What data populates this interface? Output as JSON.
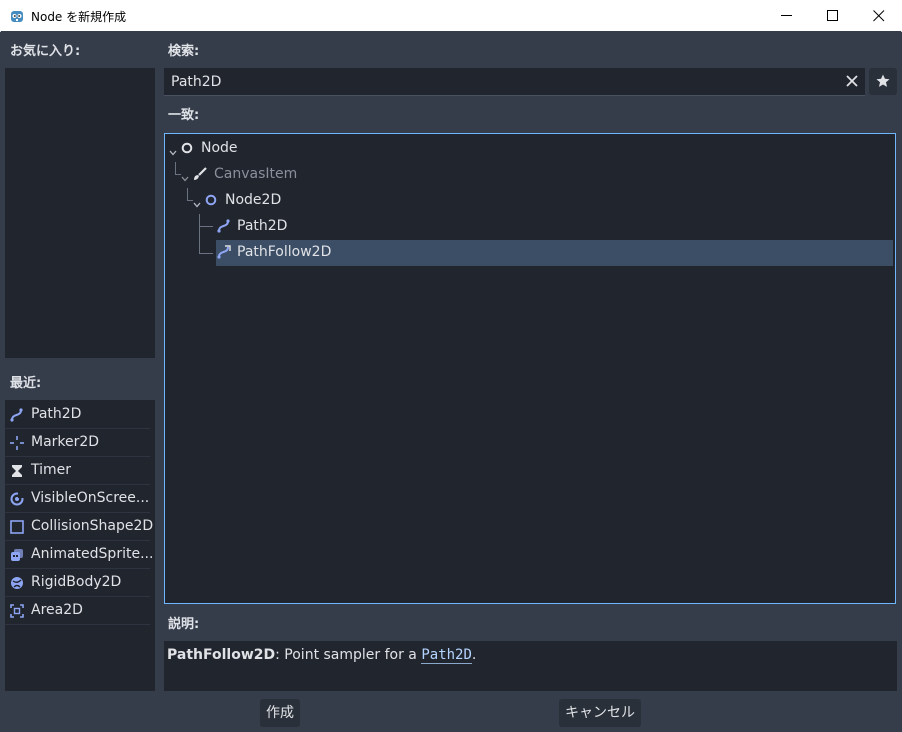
{
  "window": {
    "title": "Node を新規作成",
    "minimize_icon": "minimize-icon",
    "maximize_icon": "maximize-icon",
    "close_icon": "close-icon"
  },
  "favorites": {
    "label": "お気に入り:"
  },
  "recent": {
    "label": "最近:",
    "items": [
      {
        "label": "Path2D",
        "icon": "path2d-icon"
      },
      {
        "label": "Marker2D",
        "icon": "marker2d-icon"
      },
      {
        "label": "Timer",
        "icon": "timer-icon"
      },
      {
        "label": "VisibleOnScree...",
        "icon": "visible-on-screen-icon"
      },
      {
        "label": "CollisionShape2D",
        "icon": "collision-shape-icon"
      },
      {
        "label": "AnimatedSprite...",
        "icon": "animated-sprite-icon"
      },
      {
        "label": "RigidBody2D",
        "icon": "rigid-body-icon"
      },
      {
        "label": "Area2D",
        "icon": "area2d-icon"
      }
    ]
  },
  "search": {
    "label": "検索:",
    "value": "Path2D",
    "clear_icon": "clear-icon",
    "favorite_icon": "star-icon"
  },
  "matches": {
    "label": "一致:",
    "tree": [
      {
        "label": "Node",
        "icon": "node-icon",
        "expanded": true
      },
      {
        "label": "CanvasItem",
        "icon": "brush-icon",
        "expanded": true,
        "dimmed": true
      },
      {
        "label": "Node2D",
        "icon": "node2d-icon",
        "expanded": true
      },
      {
        "label": "Path2D",
        "icon": "path2d-icon"
      },
      {
        "label": "PathFollow2D",
        "icon": "path-follow-icon",
        "selected": true
      }
    ]
  },
  "description": {
    "label": "説明:",
    "class_name": "PathFollow2D",
    "text": ": Point sampler for a ",
    "link": "Path2D",
    "suffix": "."
  },
  "buttons": {
    "create": "作成",
    "cancel": "キャンセル"
  },
  "colors": {
    "accent": "#6fb6ff",
    "selection": "#3c4e66",
    "icon_blue": "#8da5f3",
    "panel": "#21252e",
    "background": "#363d4a"
  }
}
